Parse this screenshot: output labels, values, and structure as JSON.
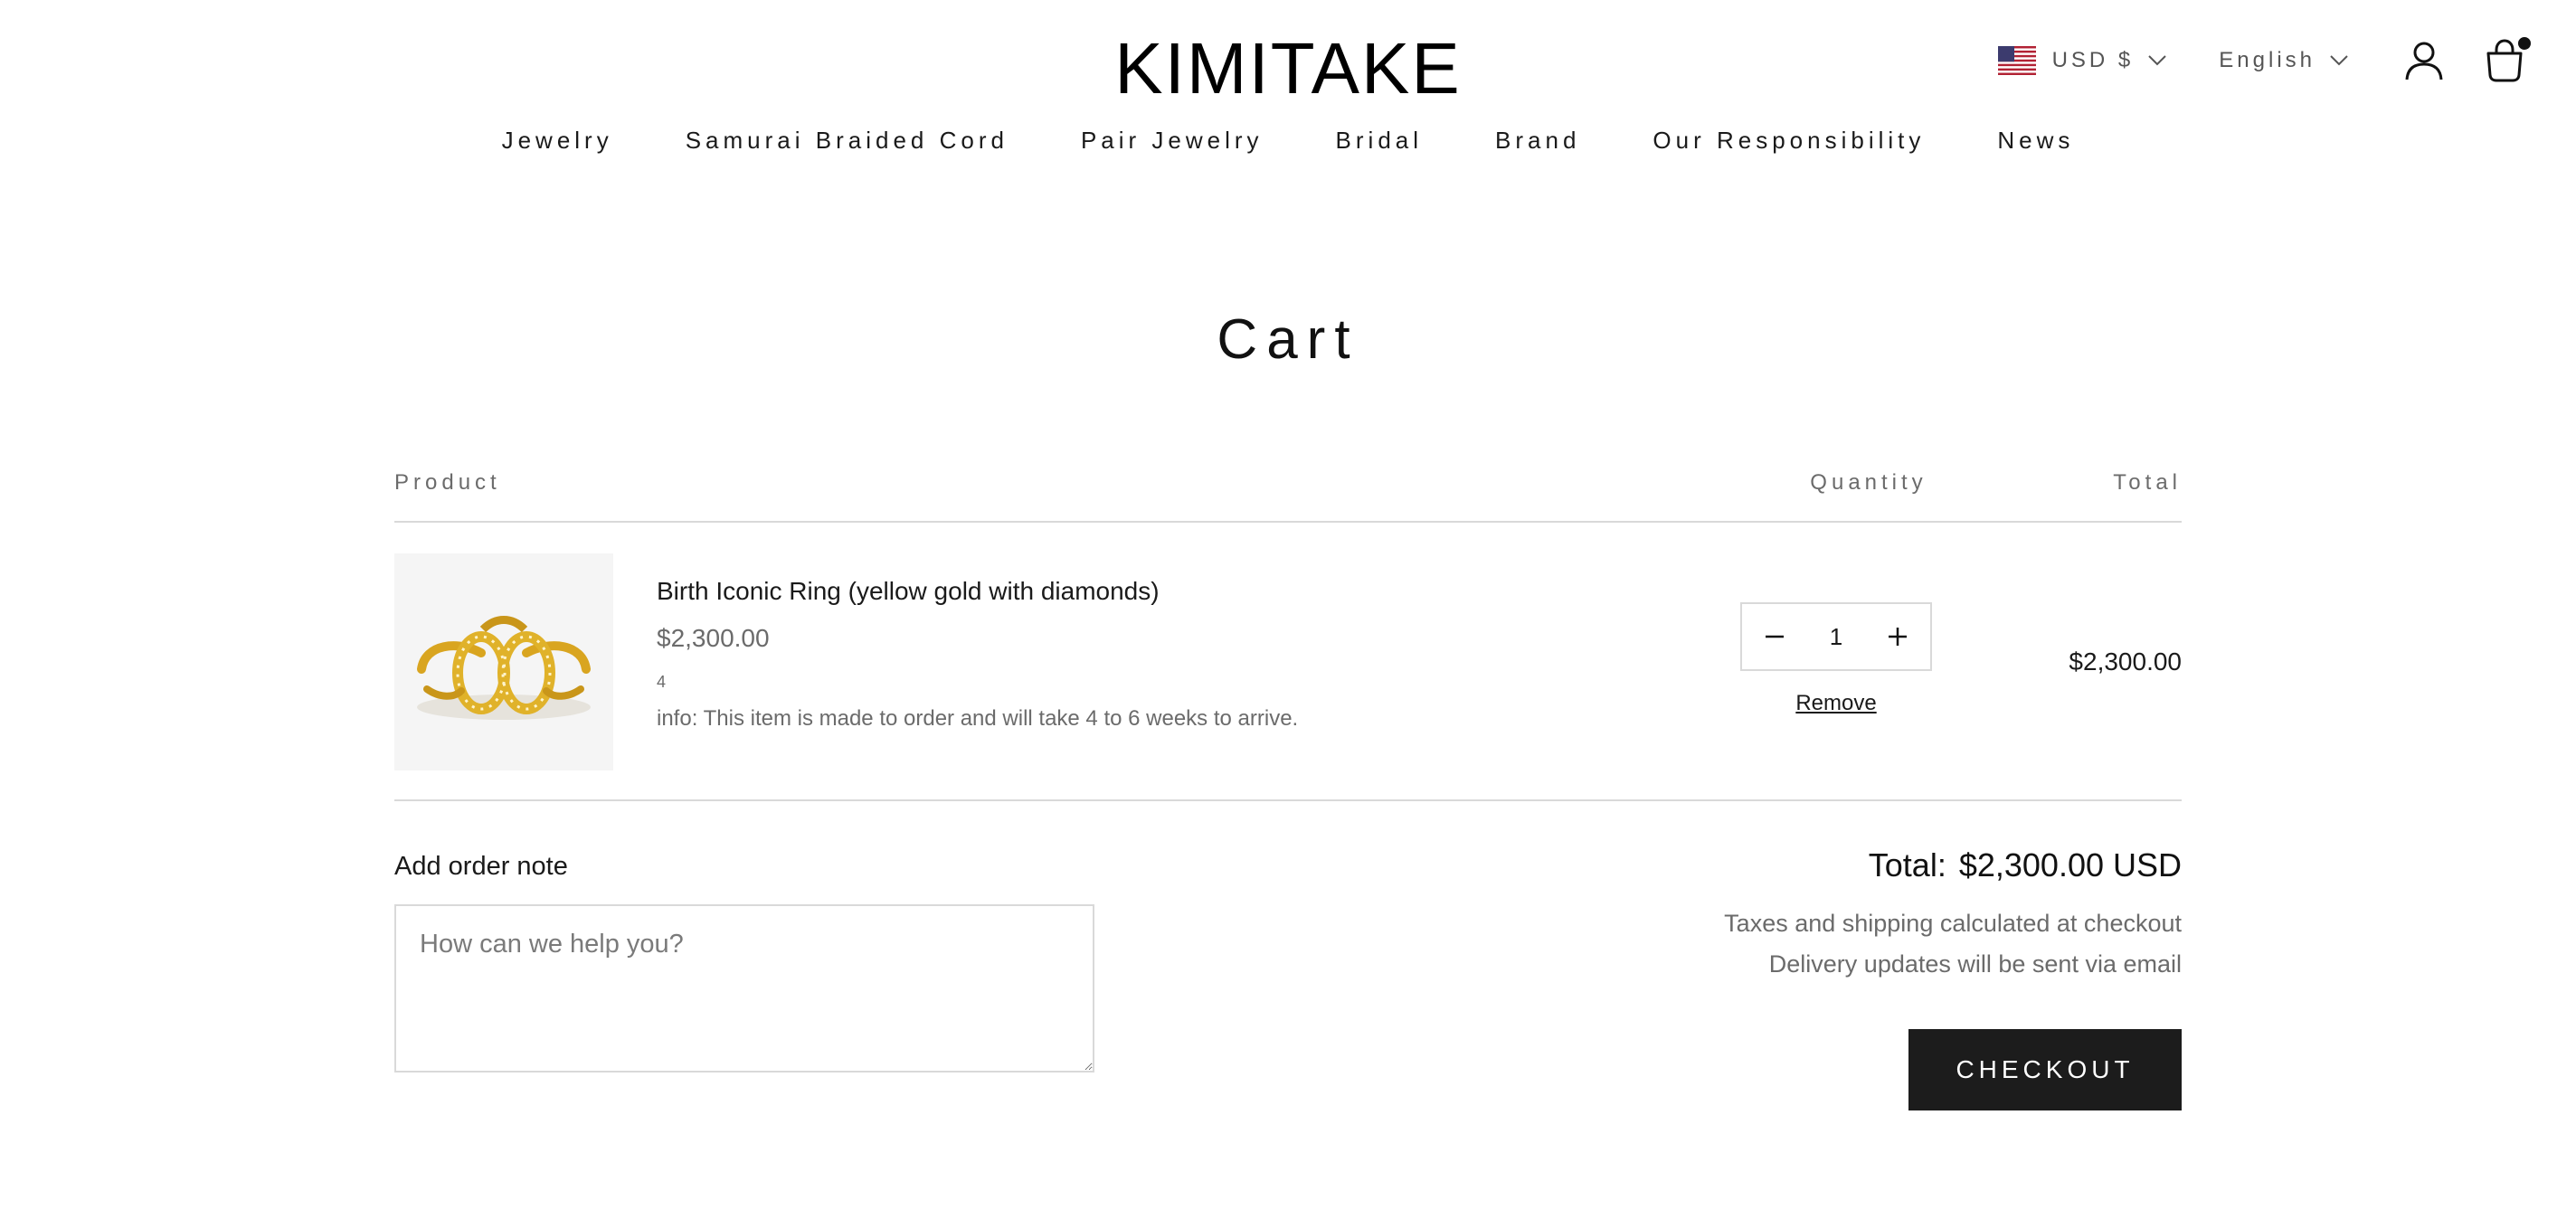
{
  "header": {
    "logo": "KIMITAKE",
    "currency_label": "USD $",
    "language_label": "English",
    "icons": {
      "flag": "us-flag-icon",
      "account": "user-icon",
      "cart": "shopping-bag-icon"
    },
    "cart_has_items": true
  },
  "nav": {
    "items": [
      {
        "label": "Jewelry"
      },
      {
        "label": "Samurai Braided Cord"
      },
      {
        "label": "Pair Jewelry"
      },
      {
        "label": "Bridal"
      },
      {
        "label": "Brand"
      },
      {
        "label": "Our Responsibility"
      },
      {
        "label": "News"
      }
    ]
  },
  "cart": {
    "title": "Cart",
    "columns": {
      "product": "Product",
      "quantity": "Quantity",
      "total": "Total"
    },
    "items": [
      {
        "name": "Birth Iconic Ring (yellow gold with diamonds)",
        "price": "$2,300.00",
        "variant": "4",
        "note": "info: This item is made to order and will take 4 to 6 weeks to arrive.",
        "quantity": "1",
        "line_total": "$2,300.00",
        "remove_label": "Remove",
        "image": "gold-diamond-ring-image"
      }
    ]
  },
  "order_note": {
    "label": "Add order note",
    "placeholder": "How can we help you?"
  },
  "summary": {
    "total_label": "Total:",
    "total_value": "$2,300.00 USD",
    "tax_text": "Taxes and shipping calculated at checkout",
    "delivery_text": "Delivery updates will be sent via email",
    "checkout_label": "CHECKOUT"
  },
  "colors": {
    "text": "#1a1a1a",
    "muted": "#6b6b6b",
    "divider": "#d9d9d9",
    "button_bg": "#1c1c1c",
    "button_text": "#ffffff"
  }
}
